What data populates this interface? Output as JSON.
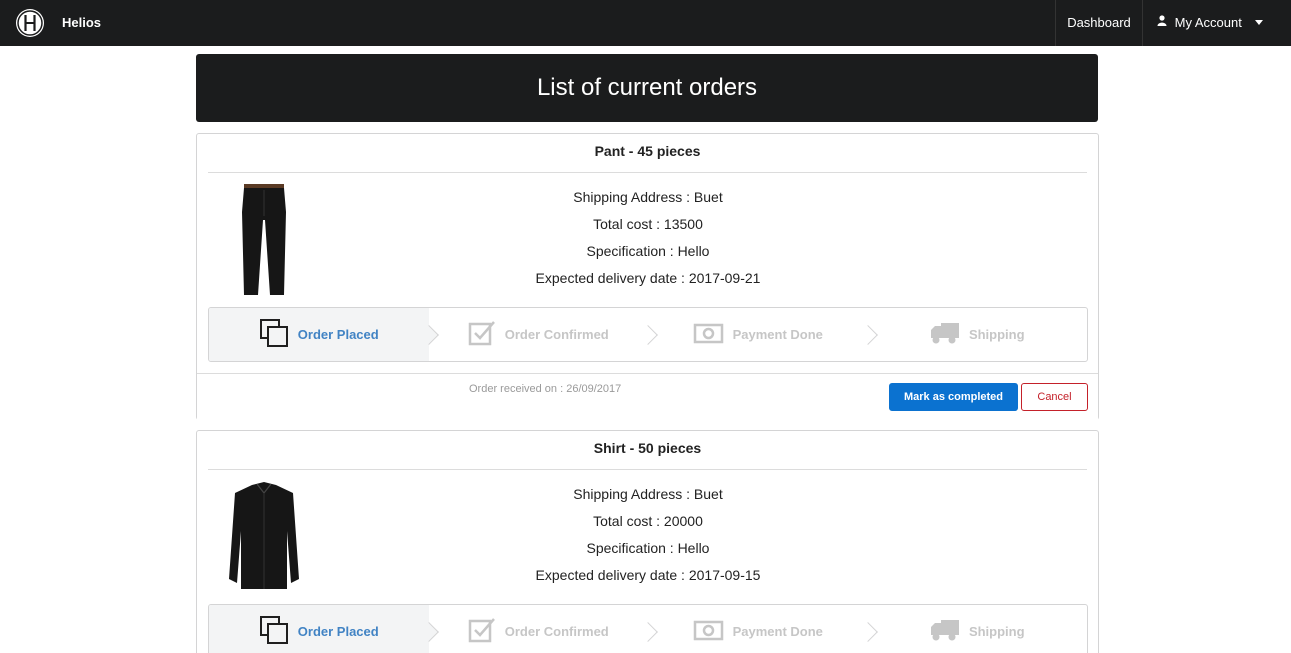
{
  "app": {
    "brand": "Helios",
    "logo_letter": "H"
  },
  "nav": {
    "dashboard": "Dashboard",
    "account": "My Account"
  },
  "page": {
    "title": "List of current orders"
  },
  "steps": [
    "Order Placed",
    "Order Confirmed",
    "Payment Done",
    "Shipping"
  ],
  "orders": [
    {
      "title": "Pant - 45 pieces",
      "shipping": "Shipping Address : Buet",
      "cost": "Total cost : 13500",
      "spec": "Specification : Hello",
      "delivery": "Expected delivery date : 2017-09-21",
      "received": "Order received on : 26/09/2017",
      "complete_label": "Mark as completed",
      "cancel_label": "Cancel",
      "active_step": 0
    },
    {
      "title": "Shirt - 50 pieces",
      "shipping": "Shipping Address : Buet",
      "cost": "Total cost : 20000",
      "spec": "Specification : Hello",
      "delivery": "Expected delivery date : 2017-09-15",
      "active_step": 0
    }
  ],
  "colors": {
    "accent": "#4183c4",
    "primary_button": "#0b72d0",
    "danger": "#c4212a",
    "dark": "#1b1c1d"
  }
}
